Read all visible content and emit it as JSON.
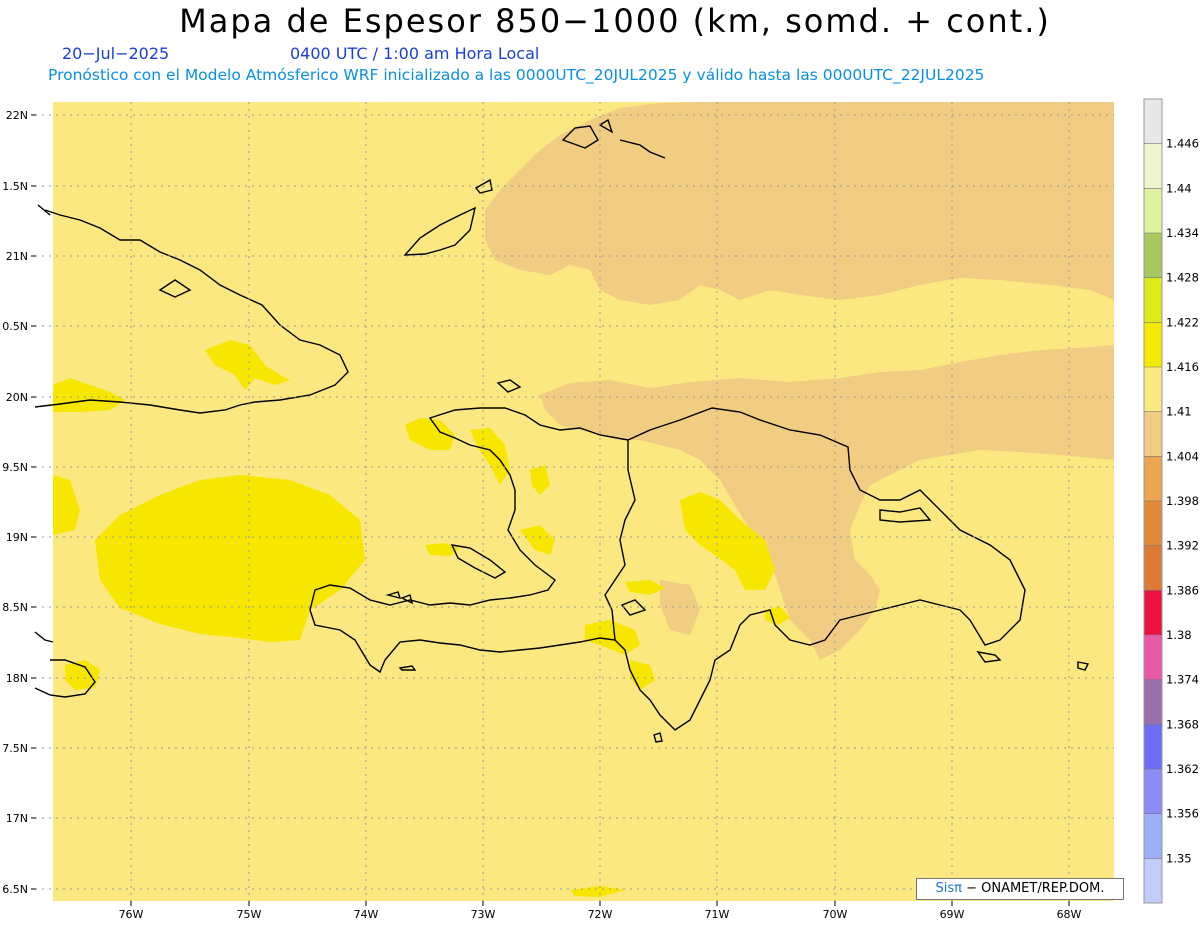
{
  "title": "Mapa de Espesor 850−1000 (km, somd. + cont.)",
  "date": "20−Jul−2025",
  "time": "0400 UTC / 1:00 am Hora Local",
  "forecast": "Pronóstico con el Modelo Atmósferico WRF inicializado a las 0000UTC_20JUL2025 y válido hasta las  0000UTC_22JUL2025",
  "credit": {
    "brand": "Sisπ",
    "text": "− ONAMET/REP.DOM."
  },
  "lat_labels": [
    "22N",
    "1.5N",
    "21N",
    "0.5N",
    "20N",
    "9.5N",
    "19N",
    "8.5N",
    "18N",
    "7.5N",
    "17N",
    "6.5N"
  ],
  "lon_labels": [
    "76W",
    "75W",
    "74W",
    "73W",
    "72W",
    "71W",
    "70W",
    "69W",
    "68W"
  ],
  "colorbar": {
    "labels": [
      "1.446",
      "1.44",
      "1.434",
      "1.428",
      "1.422",
      "1.416",
      "1.41",
      "1.404",
      "1.398",
      "1.392",
      "1.386",
      "1.38",
      "1.374",
      "1.368",
      "1.362",
      "1.356",
      "1.35"
    ],
    "colors": [
      "#e8e8e8",
      "#f0f5d0",
      "#dff2a0",
      "#a8c860",
      "#dcea1a",
      "#f4ea00",
      "#fbe880",
      "#f1cd83",
      "#eca652",
      "#e28a3a",
      "#dd7a36",
      "#ee1040",
      "#e85aa8",
      "#9a6fac",
      "#6c6cf4",
      "#8c8cf8",
      "#9ab0f8",
      "#c0ccfa"
    ]
  },
  "map_colors": {
    "ocean": "#fbe880",
    "warm": "#f1cd83",
    "cool": "#f6e600"
  }
}
